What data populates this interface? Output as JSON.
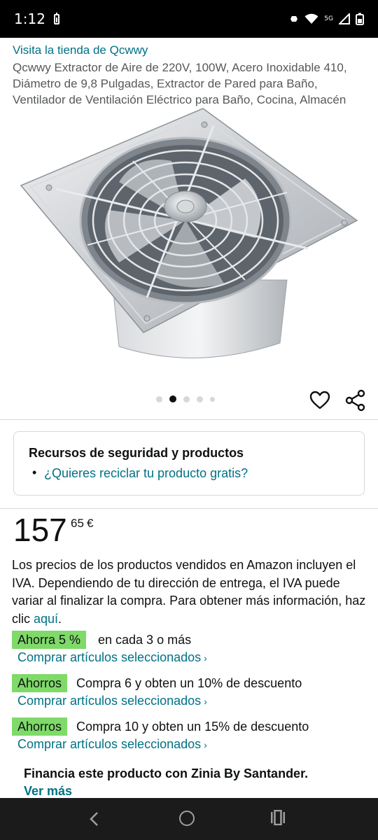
{
  "status_bar": {
    "time": "1:12",
    "network": "5G"
  },
  "store": {
    "link_text": "Visita la tienda de Qcwwy"
  },
  "product": {
    "title": "Qcwwy Extractor de Aire de 220V, 100W, Acero Inoxidable 410, Diámetro de 9,8 Pulgadas, Extractor de Pared para Baño, Ventilador de Ventilación Eléctrico para Baño, Cocina, Almacén",
    "image_desc": "stainless-steel-wall-extractor-fan"
  },
  "carousel": {
    "count": 5,
    "active_index": 1
  },
  "actions": {
    "wishlist_icon": "heart-icon",
    "share_icon": "share-icon"
  },
  "safety": {
    "title": "Recursos de seguridad y productos",
    "bullet": "•",
    "link": "¿Quieres reciclar tu producto gratis?"
  },
  "price": {
    "whole": "157",
    "fraction": "65",
    "currency": "€"
  },
  "vat_notice": {
    "text": "Los precios de los productos vendidos en Amazon incluyen el IVA. Dependiendo de tu dirección de entrega, el IVA puede variar al finalizar la compra. Para obtener más información, haz clic ",
    "link": "aquí",
    "end": "."
  },
  "promotions": [
    {
      "badge": "Ahorra 5 %",
      "text": "en cada 3 o más",
      "link": "Comprar artículos seleccionados",
      "chevron": "›"
    },
    {
      "badge": "Ahorros",
      "text": "Compra 6 y obten un 10% de descuento",
      "link": "Comprar artículos seleccionados",
      "chevron": "›"
    },
    {
      "badge": "Ahorros",
      "text": "Compra 10 y obten un 15% de descuento",
      "link": "Comprar artículos seleccionados",
      "chevron": "›"
    }
  ],
  "financing": {
    "title": "Financia este producto con Zinia By Santander.",
    "link": "Ver más"
  },
  "colors": {
    "link": "#007185",
    "badge_green": "#7fda69",
    "text": "#0f1111"
  }
}
